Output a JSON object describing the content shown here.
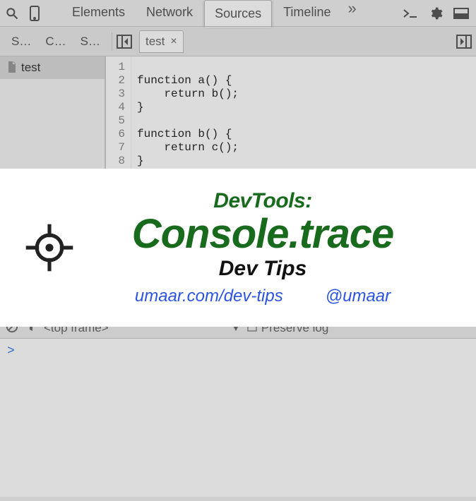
{
  "toolbar": {
    "tabs": [
      "Elements",
      "Network",
      "Sources",
      "Timeline"
    ],
    "activeTab": "Sources",
    "more": "»"
  },
  "subbar": {
    "shortTabs": [
      "S…",
      "C…",
      "S…"
    ],
    "fileTab": "test",
    "closeGlyph": "×"
  },
  "navigator": {
    "fileLabel": "test"
  },
  "code": {
    "lineNumbers": [
      "1",
      "2",
      "3",
      "4",
      "5",
      "6",
      "7",
      "8"
    ],
    "lines": [
      "function a() {",
      "    return b();",
      "}",
      "",
      "function b() {",
      "    return c();",
      "}",
      ""
    ]
  },
  "consoleBar": {
    "frameLabel": "<top frame>",
    "dropdownGlyph": "▼",
    "preserveLabel": "Preserve log"
  },
  "consoleBody": {
    "prompt": ">"
  },
  "overlay": {
    "title1": "DevTools:",
    "title2": "Console.trace",
    "subtitle": "Dev Tips",
    "link1": "umaar.com/dev-tips",
    "link2": "@umaar"
  }
}
